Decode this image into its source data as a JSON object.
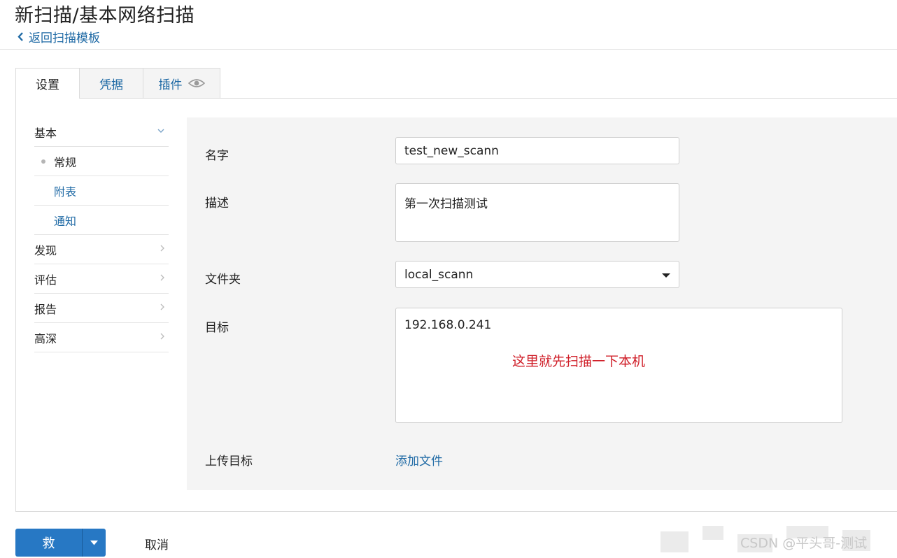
{
  "page": {
    "title": "新扫描/基本网络扫描",
    "back_link": "返回扫描模板"
  },
  "tabs": [
    {
      "label": "设置"
    },
    {
      "label": "凭据"
    },
    {
      "label": "插件"
    }
  ],
  "sidebar": {
    "items": [
      {
        "label": "基本"
      },
      {
        "label": "常规"
      },
      {
        "label": "附表"
      },
      {
        "label": "通知"
      },
      {
        "label": "发现"
      },
      {
        "label": "评估"
      },
      {
        "label": "报告"
      },
      {
        "label": "高深"
      }
    ]
  },
  "form": {
    "name": {
      "label": "名字",
      "value": "test_new_scann"
    },
    "description": {
      "label": "描述",
      "value": "第一次扫描测试"
    },
    "folder": {
      "label": "文件夹",
      "value": "local_scann"
    },
    "targets": {
      "label": "目标",
      "value": "192.168.0.241"
    },
    "upload": {
      "label": "上传目标",
      "link": "添加文件"
    }
  },
  "annotation": "这里就先扫描一下本机",
  "footer": {
    "save_label": "救",
    "cancel_label": "取消"
  },
  "watermark": "CSDN @平头哥-测试",
  "colors": {
    "accent": "#2778c4",
    "link": "#1f6aa5",
    "annotation": "#d0202a"
  }
}
